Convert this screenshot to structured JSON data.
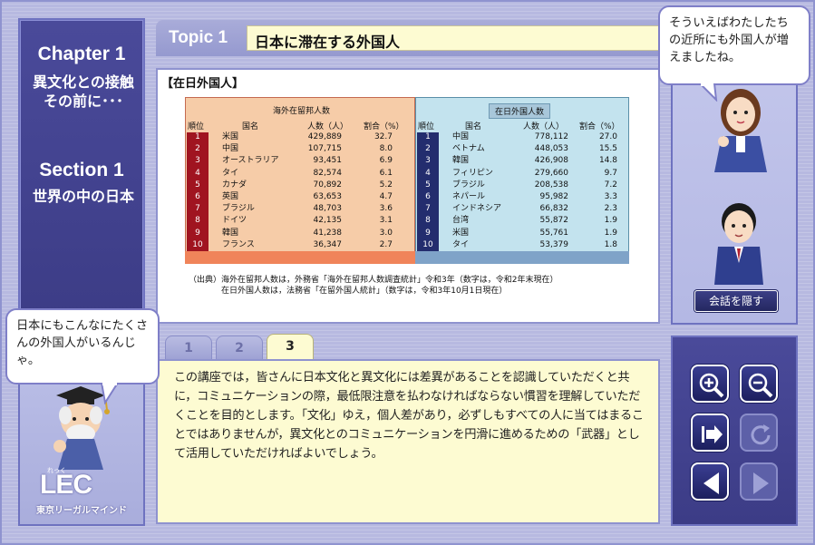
{
  "left_panel": {
    "chapter_label": "Chapter 1",
    "chapter_title": "異文化との接触その前に･･･",
    "section_label": "Section 1",
    "section_title": "世界の中の日本"
  },
  "topic": {
    "label": "Topic 1",
    "title": "日本に滞在する外国人"
  },
  "content": {
    "heading": "【在日外国人】",
    "overseas": {
      "title": "海外在留邦人数",
      "columns": [
        "順位",
        "国名",
        "人数（人）",
        "割合（%）"
      ],
      "rows": [
        {
          "rank": "1",
          "name": "米国",
          "count": "429,889",
          "pct": "32.7"
        },
        {
          "rank": "2",
          "name": "中国",
          "count": "107,715",
          "pct": "8.0"
        },
        {
          "rank": "3",
          "name": "オーストラリア",
          "count": "93,451",
          "pct": "6.9"
        },
        {
          "rank": "4",
          "name": "タイ",
          "count": "82,574",
          "pct": "6.1"
        },
        {
          "rank": "5",
          "name": "カナダ",
          "count": "70,892",
          "pct": "5.2"
        },
        {
          "rank": "6",
          "name": "英国",
          "count": "63,653",
          "pct": "4.7"
        },
        {
          "rank": "7",
          "name": "ブラジル",
          "count": "48,703",
          "pct": "3.6"
        },
        {
          "rank": "8",
          "name": "ドイツ",
          "count": "42,135",
          "pct": "3.1"
        },
        {
          "rank": "9",
          "name": "韓国",
          "count": "41,238",
          "pct": "3.0"
        },
        {
          "rank": "10",
          "name": "フランス",
          "count": "36,347",
          "pct": "2.7"
        }
      ]
    },
    "foreign": {
      "title": "在日外国人数",
      "columns": [
        "順位",
        "国名",
        "人数（人）",
        "割合（%）"
      ],
      "rows": [
        {
          "rank": "1",
          "name": "中国",
          "count": "778,112",
          "pct": "27.0"
        },
        {
          "rank": "2",
          "name": "ベトナム",
          "count": "448,053",
          "pct": "15.5"
        },
        {
          "rank": "3",
          "name": "韓国",
          "count": "426,908",
          "pct": "14.8"
        },
        {
          "rank": "4",
          "name": "フィリピン",
          "count": "279,660",
          "pct": "9.7"
        },
        {
          "rank": "5",
          "name": "ブラジル",
          "count": "208,538",
          "pct": "7.2"
        },
        {
          "rank": "6",
          "name": "ネパール",
          "count": "95,982",
          "pct": "3.3"
        },
        {
          "rank": "7",
          "name": "インドネシア",
          "count": "66,832",
          "pct": "2.3"
        },
        {
          "rank": "8",
          "name": "台湾",
          "count": "55,872",
          "pct": "1.9"
        },
        {
          "rank": "9",
          "name": "米国",
          "count": "55,761",
          "pct": "1.9"
        },
        {
          "rank": "10",
          "name": "タイ",
          "count": "53,379",
          "pct": "1.8"
        }
      ]
    },
    "source_line1": "（出典）海外在留邦人数は，外務省「海外在留邦人数調査統計」令和3年（数字は，令和2年末現在）",
    "source_line2": "在日外国人数は，法務省「在留外国人統計」（数字は，令和3年10月1日現在）"
  },
  "tabs": [
    {
      "label": "1",
      "active": false
    },
    {
      "label": "2",
      "active": false
    },
    {
      "label": "3",
      "active": true
    }
  ],
  "body_text": "この講座では，皆さんに日本文化と異文化には差異があることを認識していただくと共に，コミュニケーションの際，最低限注意を払わなければならない慣習を理解していただくことを目的とします。「文化」ゆえ，個人差があり，必ずしもすべての人に当てはまることではありませんが，異文化とのコミュニケーションを円滑に進めるための「武器」として活用していただければよいでしょう。",
  "bubbles": {
    "woman": "そういえばわたしたちの近所にも外国人が増えましたね。",
    "professor": "日本にもこんなにたくさんの外国人がいるんじゃ。"
  },
  "hide_dialog_label": "会話を隠す",
  "logo": {
    "name": "LEC",
    "ruby": "れっく",
    "subtitle": "東京リーガルマインド"
  },
  "controls": [
    "zoom-in-icon",
    "zoom-out-icon",
    "skip-icon",
    "replay-icon",
    "prev-icon",
    "next-icon"
  ],
  "colors": {
    "panel_dark": "#3c3c86",
    "panel_light": "#b9bde6",
    "text_bg": "#fdfbd2",
    "overseas_rank": "#a01420",
    "foreign_rank": "#232d6e"
  }
}
